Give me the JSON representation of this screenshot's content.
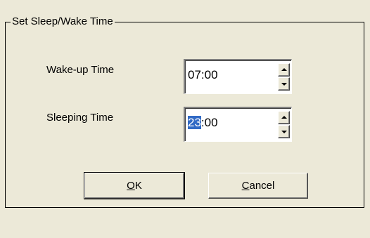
{
  "dialog": {
    "group_title": "Set Sleep/Wake Time"
  },
  "wake": {
    "label": "Wake-up Time",
    "value_selected": "",
    "value_rest": "07:00"
  },
  "sleep": {
    "label": "Sleeping Time",
    "value_selected": "23",
    "value_rest": ":00"
  },
  "buttons": {
    "ok": {
      "mnemonic": "O",
      "rest": "K"
    },
    "cancel": {
      "mnemonic": "C",
      "rest": "ancel"
    }
  },
  "colors": {
    "background": "#ece9d8",
    "selection": "#316ac5"
  },
  "icons": {
    "spin_up": "arrow-up",
    "spin_down": "arrow-down"
  }
}
